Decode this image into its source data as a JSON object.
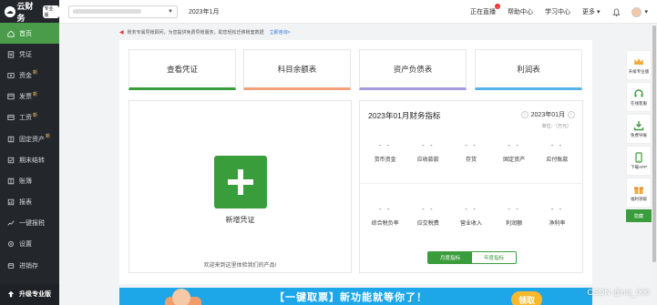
{
  "brand": {
    "name": "云财务",
    "badge": "专业版"
  },
  "sidebar": {
    "items": [
      {
        "label": "首页",
        "icon": "home-icon",
        "active": true,
        "sup": ""
      },
      {
        "label": "凭证",
        "icon": "voucher-icon",
        "active": false,
        "sup": ""
      },
      {
        "label": "资金",
        "icon": "fund-icon",
        "active": false,
        "sup": "新"
      },
      {
        "label": "发票",
        "icon": "invoice-icon",
        "active": false,
        "sup": "新"
      },
      {
        "label": "工资",
        "icon": "salary-icon",
        "active": false,
        "sup": "新"
      },
      {
        "label": "固定资产",
        "icon": "asset-icon",
        "active": false,
        "sup": "新"
      },
      {
        "label": "期末结转",
        "icon": "closing-icon",
        "active": false,
        "sup": ""
      },
      {
        "label": "账簿",
        "icon": "ledger-icon",
        "active": false,
        "sup": ""
      },
      {
        "label": "报表",
        "icon": "report-icon",
        "active": false,
        "sup": ""
      },
      {
        "label": "一键报税",
        "icon": "tax-icon",
        "active": false,
        "sup": ""
      },
      {
        "label": "设置",
        "icon": "settings-icon",
        "active": false,
        "sup": ""
      },
      {
        "label": "进销存",
        "icon": "inventory-icon",
        "active": false,
        "sup": ""
      }
    ],
    "upgrade_label": "升级专业版"
  },
  "topbar": {
    "period": "2023年1月",
    "live": "正在直播",
    "help": "帮助中心",
    "learn": "学习中心",
    "more": "更多"
  },
  "notice": {
    "text": "账务专属导账顾问，为您提供免费导账服务，助您轻松迁移账套数据",
    "link": "立即咨询>"
  },
  "tiles": [
    {
      "label": "查看凭证",
      "color": "#3a9d3c"
    },
    {
      "label": "科目余额表",
      "color": "#f2a279"
    },
    {
      "label": "资产负债表",
      "color": "#a79be0"
    },
    {
      "label": "利润表",
      "color": "#56b4e9"
    }
  ],
  "new_voucher": {
    "label": "新增凭证",
    "welcome": "欢迎来到这里体验我们的产品!"
  },
  "finance": {
    "title": "2023年01月财务指标",
    "period": "2023年01月",
    "unit": "单位：（万元）",
    "row1": [
      {
        "label": "货币资金",
        "value": "- -"
      },
      {
        "label": "应收款款",
        "value": "- -"
      },
      {
        "label": "存货",
        "value": "- -"
      },
      {
        "label": "固定资产",
        "value": "- -"
      },
      {
        "label": "应付账款",
        "value": "- -"
      }
    ],
    "row2": [
      {
        "label": "综合税负率",
        "value": "- -"
      },
      {
        "label": "应交税费",
        "value": "- -"
      },
      {
        "label": "营业收入",
        "value": "- -"
      },
      {
        "label": "利润额",
        "value": "- -"
      },
      {
        "label": "净利率",
        "value": "- -"
      }
    ],
    "toggle": {
      "monthly": "月度指标",
      "annual": "年度指标"
    }
  },
  "banner": {
    "text": "【一键取票】新功能就等你了！",
    "button": "领取"
  },
  "right_rail": {
    "items": [
      {
        "label": "升级专业版",
        "icon": "crown-icon"
      },
      {
        "label": "在线客服",
        "icon": "headset-icon"
      },
      {
        "label": "免费导账",
        "icon": "import-icon"
      },
      {
        "label": "下载APP",
        "icon": "mobile-icon"
      },
      {
        "label": "福利领取",
        "icon": "gift-icon"
      }
    ],
    "hide_label": "隐藏"
  },
  "watermark": "CSDN @mlj_000"
}
